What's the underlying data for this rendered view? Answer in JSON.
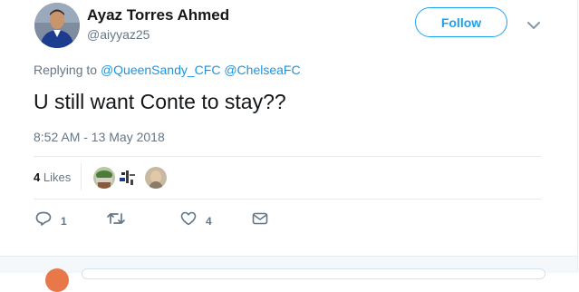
{
  "author": {
    "display_name": "Ayaz Torres Ahmed",
    "handle": "@aiyyaz25"
  },
  "follow_label": "Follow",
  "reply_context": {
    "prefix": "Replying to",
    "mentions": [
      "@QueenSandy_CFC",
      "@ChelseaFC"
    ]
  },
  "tweet": {
    "text": "U still want Conte to stay??",
    "timestamp": "8:52 AM - 13 May 2018"
  },
  "likes": {
    "count": "4",
    "label": "Likes"
  },
  "actions": {
    "reply_count": "1",
    "retweet_count": "",
    "like_count": "4"
  },
  "colors": {
    "accent": "#1da1f2",
    "secondary_text": "#657786",
    "primary_text": "#14171a"
  }
}
